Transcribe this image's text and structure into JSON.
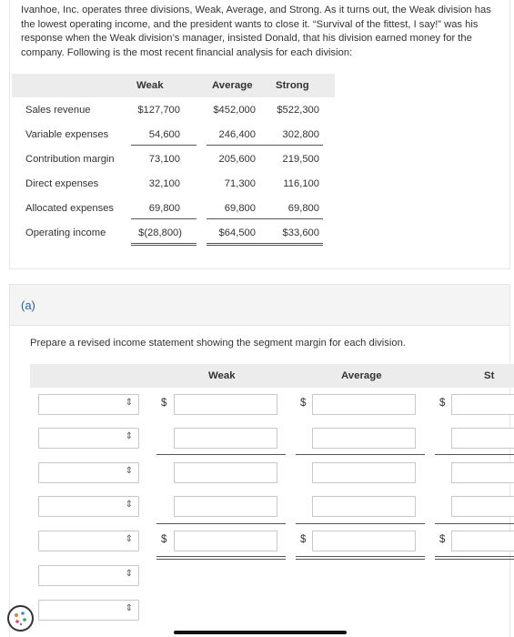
{
  "intro": {
    "text": "Ivanhoe, Inc. operates three divisions, Weak, Average, and Strong. As it turns out, the Weak division has the lowest operating income, and the president wants to close it. “Survival of the fittest, I say!” was his response when the Weak division’s manager, insisted Donald, that his division earned money for the company. Following is the most recent financial analysis for each division:"
  },
  "financials": {
    "columns": [
      "Weak",
      "Average",
      "Strong"
    ],
    "rows": [
      {
        "label": "Sales revenue",
        "values": [
          "$127,700",
          "$452,000",
          "$522,300"
        ]
      },
      {
        "label": "Variable expenses",
        "values": [
          "54,600",
          "246,400",
          "302,800"
        ]
      },
      {
        "label": "Contribution margin",
        "values": [
          "73,100",
          "205,600",
          "219,500"
        ]
      },
      {
        "label": "Direct expenses",
        "values": [
          "32,100",
          "71,300",
          "116,100"
        ]
      },
      {
        "label": "Allocated expenses",
        "values": [
          "69,800",
          "69,800",
          "69,800"
        ]
      },
      {
        "label": "Operating income",
        "values": [
          "$(28,800)",
          "$64,500",
          "$33,600"
        ]
      }
    ]
  },
  "part_a": {
    "label": "(a)",
    "instruction": "Prepare a revised income statement showing the segment margin for each division.",
    "columns": [
      "Weak",
      "Average",
      "St"
    ],
    "currency_symbol": "$",
    "select_rows": 7
  },
  "icons": {
    "select_arrow": "up-down-chevron-icon",
    "cookie": "cookie-icon"
  },
  "colors": {
    "header_bg": "#ececec",
    "part_label": "#2a62a6"
  }
}
